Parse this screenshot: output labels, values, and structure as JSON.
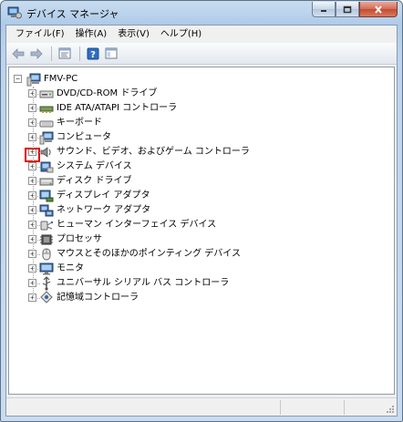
{
  "window": {
    "title": "デバイス マネージャ"
  },
  "menu": [
    {
      "label": "ファイル(F)",
      "key": "file"
    },
    {
      "label": "操作(A)",
      "key": "action"
    },
    {
      "label": "表示(V)",
      "key": "view"
    },
    {
      "label": "ヘルプ(H)",
      "key": "help"
    }
  ],
  "toolbar": [
    "back-arrow-icon",
    "forward-arrow-icon",
    "properties-icon",
    "help-icon",
    "show-hide-console-tree-icon"
  ],
  "tree": {
    "root": {
      "label": "FMV-PC",
      "icon": "computer-icon",
      "expanded": true
    },
    "items": [
      {
        "label": "DVD/CD-ROM ドライブ",
        "icon": "dvd-drive-icon"
      },
      {
        "label": "IDE ATA/ATAPI コントローラ",
        "icon": "ide-controller-icon"
      },
      {
        "label": "キーボード",
        "icon": "keyboard-icon",
        "highlighted": true
      },
      {
        "label": "コンピュータ",
        "icon": "computer-icon"
      },
      {
        "label": "サウンド、ビデオ、およびゲーム コントローラ",
        "icon": "sound-icon"
      },
      {
        "label": "システム デバイス",
        "icon": "system-device-icon"
      },
      {
        "label": "ディスク ドライブ",
        "icon": "disk-drive-icon"
      },
      {
        "label": "ディスプレイ アダプタ",
        "icon": "display-adapter-icon"
      },
      {
        "label": "ネットワーク アダプタ",
        "icon": "network-adapter-icon"
      },
      {
        "label": "ヒューマン インターフェイス デバイス",
        "icon": "hid-icon"
      },
      {
        "label": "プロセッサ",
        "icon": "processor-icon"
      },
      {
        "label": "マウスとそのほかのポインティング デバイス",
        "icon": "mouse-icon"
      },
      {
        "label": "モニタ",
        "icon": "monitor-icon"
      },
      {
        "label": "ユニバーサル シリアル バス コントローラ",
        "icon": "usb-icon"
      },
      {
        "label": "記憶域コントローラ",
        "icon": "storage-controller-icon"
      }
    ]
  },
  "colors": {
    "highlight": "#e00000",
    "title_bar": "#aecbe9",
    "close_button": "#c44b31"
  }
}
